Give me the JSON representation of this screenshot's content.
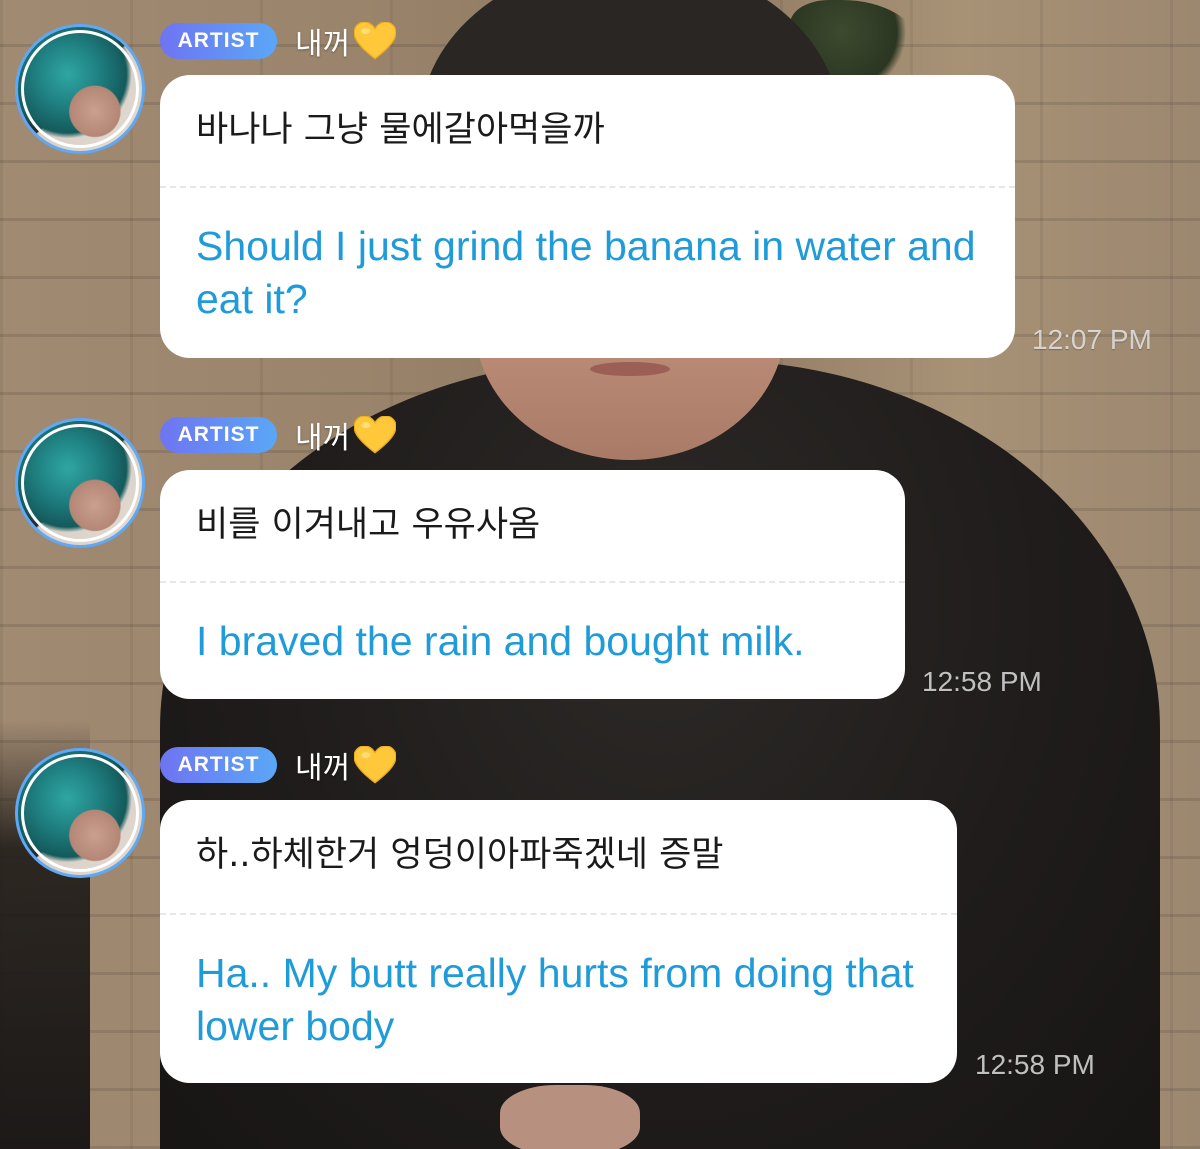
{
  "messages": [
    {
      "badge": "ARTIST",
      "sender": "내꺼",
      "heart_icon": "yellow-heart-icon",
      "korean": "바나나 그냥 물에갈아먹을까",
      "english": "Should I just grind the banana in water and eat it?",
      "time": "12:07 PM"
    },
    {
      "badge": "ARTIST",
      "sender": "내꺼",
      "heart_icon": "yellow-heart-icon",
      "korean": "비를 이겨내고 우유사옴",
      "english": "I braved the rain and bought milk.",
      "time": "12:58 PM"
    },
    {
      "badge": "ARTIST",
      "sender": "내꺼",
      "heart_icon": "yellow-heart-icon",
      "korean": "하..하체한거 엉덩이아파죽겠네 증말",
      "english": "Ha.. My butt really hurts from doing that lower body",
      "time": "12:58 PM"
    }
  ],
  "colors": {
    "badge_gradient_start": "#6f74f2",
    "badge_gradient_end": "#5aa7f6",
    "translation_text": "#1f9bd9",
    "avatar_ring": "#5fa8f5",
    "heart": "#ffc83a"
  }
}
